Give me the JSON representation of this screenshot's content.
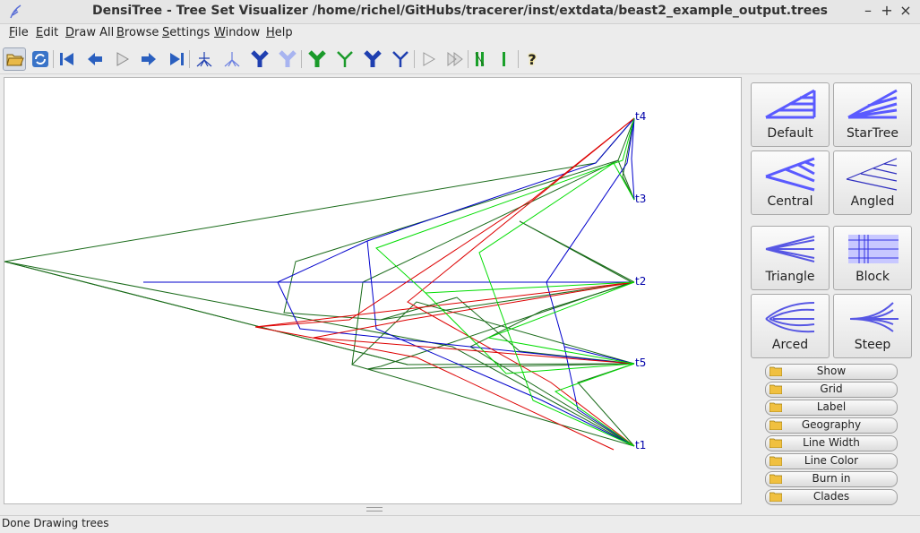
{
  "window": {
    "title": "DensiTree - Tree Set Visualizer /home/richel/GitHubs/tracerer/inst/extdata/beast2_example_output.trees",
    "controls": [
      "–",
      "+",
      "×"
    ]
  },
  "menu": [
    {
      "mnemonic": "F",
      "rest": "ile"
    },
    {
      "mnemonic": "E",
      "rest": "dit"
    },
    {
      "mnemonic": "D",
      "rest": "raw All"
    },
    {
      "mnemonic": "B",
      "rest": "rowse"
    },
    {
      "mnemonic": "S",
      "rest": "ettings"
    },
    {
      "mnemonic": "W",
      "rest": "indow"
    },
    {
      "mnemonic": "H",
      "rest": "elp"
    }
  ],
  "toolbar": {
    "icons": [
      "open-folder-icon",
      "refresh-icon",
      "first-icon",
      "previous-icon",
      "play-icon",
      "next-icon",
      "last-icon",
      "tree-blue-dense-icon",
      "tree-blue-light-icon",
      "tree-blue-icon",
      "tree-lightblue-icon",
      "tree-green-icon",
      "tree-green-thin-icon",
      "tree-blue-bold-icon",
      "tree-blue-thin-icon",
      "forward-step-icon",
      "fast-forward-icon",
      "green-bars-icon",
      "green-bar-icon",
      "help-icon"
    ],
    "help_label": "?"
  },
  "taxa": [
    "t4",
    "t3",
    "t2",
    "t5",
    "t1"
  ],
  "modes": [
    "Default",
    "StarTree",
    "Central",
    "Angled",
    "Triangle",
    "Block",
    "Arced",
    "Steep"
  ],
  "panels": [
    "Show",
    "Grid",
    "Label",
    "Geography",
    "Line Width",
    "Line Color",
    "Burn in",
    "Clades"
  ],
  "status": "Done Drawing trees",
  "colors": {
    "darkgreen": "#1a6b1a",
    "blue": "#0000cc",
    "red": "#dd0000",
    "lightgreen": "#00dd00",
    "mode_blue": "#5a5aff"
  }
}
